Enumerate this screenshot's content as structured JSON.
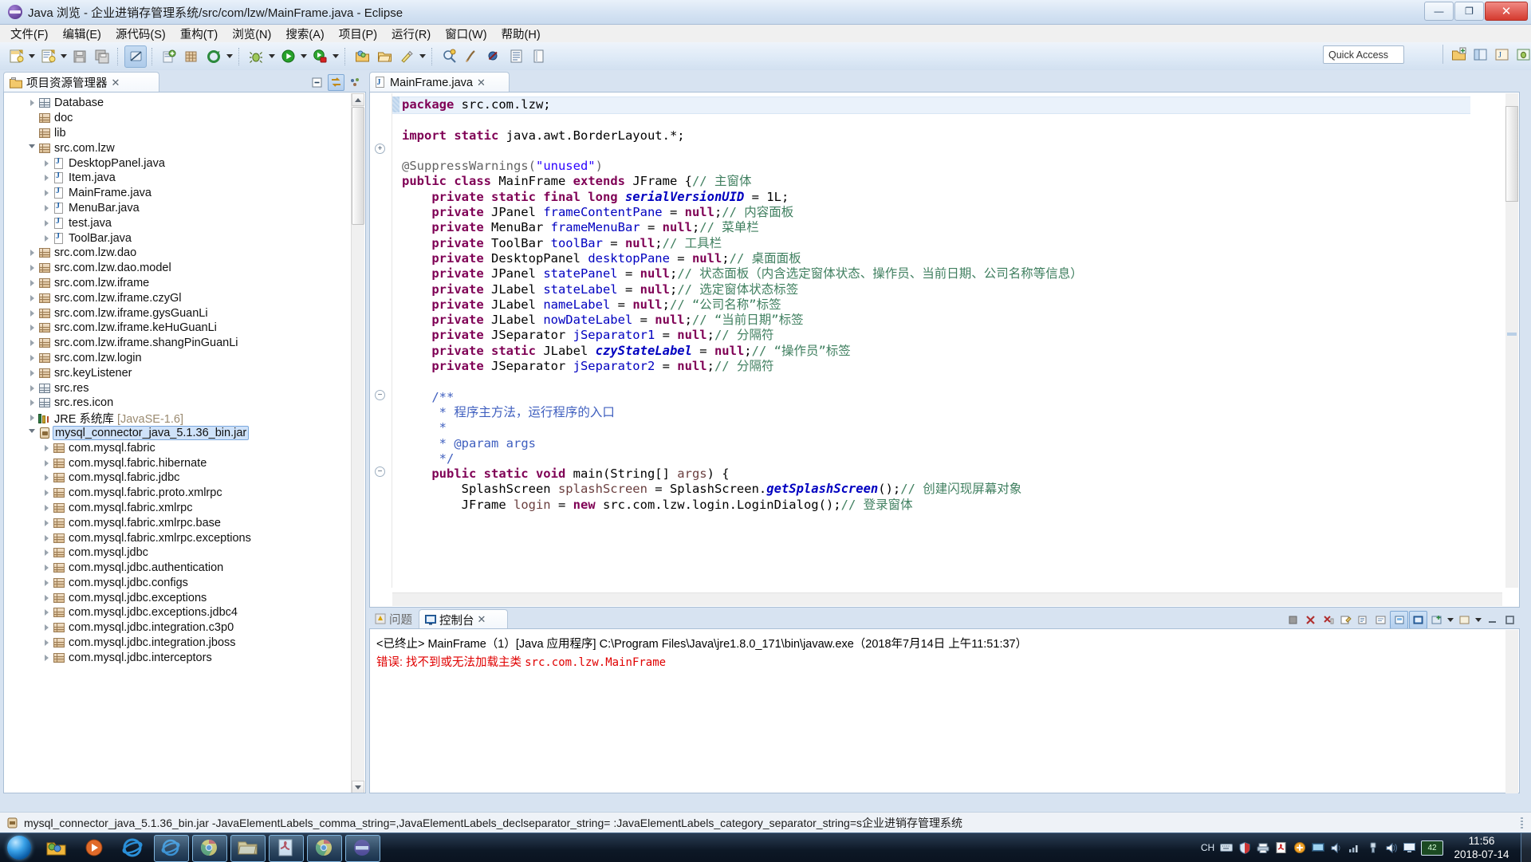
{
  "window": {
    "title": "Java 浏览 - 企业进销存管理系统/src/com/lzw/MainFrame.java - Eclipse",
    "minimize_label": "—",
    "maximize_label": "❐",
    "close_label": "✕"
  },
  "menubar": {
    "items": [
      "文件(F)",
      "编辑(E)",
      "源代码(S)",
      "重构(T)",
      "浏览(N)",
      "搜索(A)",
      "项目(P)",
      "运行(R)",
      "窗口(W)",
      "帮助(H)"
    ]
  },
  "toolbar": {
    "quick_access_placeholder": "Quick Access",
    "buttons": [
      "new-wizard",
      "new-java-class",
      "save",
      "save-all",
      "toggle-link",
      "new-java-project",
      "open-type",
      "debug",
      "run",
      "run-coverage",
      "new-package",
      "open-task",
      "external-tools",
      "search",
      "annotate",
      "skip-breakpoints",
      "outline",
      "pin"
    ]
  },
  "project_explorer": {
    "tab_label": "项目资源管理器",
    "tab_close": "✕",
    "view_icons": [
      "collapse-all-icon",
      "link-with-editor-icon",
      "view-menu-icon"
    ],
    "tree": [
      {
        "label": "Database",
        "indent": 1,
        "icon": "src-folder",
        "twisty": "closed"
      },
      {
        "label": "doc",
        "indent": 1,
        "icon": "pkg-folder",
        "twisty": "none"
      },
      {
        "label": "lib",
        "indent": 1,
        "icon": "pkg-folder",
        "twisty": "none"
      },
      {
        "label": "src.com.lzw",
        "indent": 1,
        "icon": "pkg-folder",
        "twisty": "open"
      },
      {
        "label": "DesktopPanel.java",
        "indent": 2,
        "icon": "java",
        "twisty": "closed"
      },
      {
        "label": "Item.java",
        "indent": 2,
        "icon": "java",
        "twisty": "closed"
      },
      {
        "label": "MainFrame.java",
        "indent": 2,
        "icon": "java",
        "twisty": "closed"
      },
      {
        "label": "MenuBar.java",
        "indent": 2,
        "icon": "java",
        "twisty": "closed"
      },
      {
        "label": "test.java",
        "indent": 2,
        "icon": "java",
        "twisty": "closed"
      },
      {
        "label": "ToolBar.java",
        "indent": 2,
        "icon": "java",
        "twisty": "closed"
      },
      {
        "label": "src.com.lzw.dao",
        "indent": 1,
        "icon": "pkg-folder",
        "twisty": "closed"
      },
      {
        "label": "src.com.lzw.dao.model",
        "indent": 1,
        "icon": "pkg-folder",
        "twisty": "closed"
      },
      {
        "label": "src.com.lzw.iframe",
        "indent": 1,
        "icon": "pkg-folder",
        "twisty": "closed"
      },
      {
        "label": "src.com.lzw.iframe.czyGl",
        "indent": 1,
        "icon": "pkg-folder",
        "twisty": "closed"
      },
      {
        "label": "src.com.lzw.iframe.gysGuanLi",
        "indent": 1,
        "icon": "pkg-folder",
        "twisty": "closed"
      },
      {
        "label": "src.com.lzw.iframe.keHuGuanLi",
        "indent": 1,
        "icon": "pkg-folder",
        "twisty": "closed"
      },
      {
        "label": "src.com.lzw.iframe.shangPinGuanLi",
        "indent": 1,
        "icon": "pkg-folder",
        "twisty": "closed"
      },
      {
        "label": "src.com.lzw.login",
        "indent": 1,
        "icon": "pkg-folder",
        "twisty": "closed"
      },
      {
        "label": "src.keyListener",
        "indent": 1,
        "icon": "pkg-folder",
        "twisty": "closed"
      },
      {
        "label": "src.res",
        "indent": 1,
        "icon": "src-folder",
        "twisty": "closed"
      },
      {
        "label": "src.res.icon",
        "indent": 1,
        "icon": "src-folder",
        "twisty": "closed"
      },
      {
        "label": "JRE 系统库 ",
        "dim": "[JavaSE-1.6]",
        "indent": 1,
        "icon": "jre",
        "twisty": "closed"
      },
      {
        "label": "mysql_connector_java_5.1.36_bin.jar",
        "indent": 1,
        "icon": "jar",
        "twisty": "open",
        "selected": true
      },
      {
        "label": "com.mysql.fabric",
        "indent": 2,
        "icon": "pkg-folder",
        "twisty": "closed"
      },
      {
        "label": "com.mysql.fabric.hibernate",
        "indent": 2,
        "icon": "pkg-folder",
        "twisty": "closed"
      },
      {
        "label": "com.mysql.fabric.jdbc",
        "indent": 2,
        "icon": "pkg-folder",
        "twisty": "closed"
      },
      {
        "label": "com.mysql.fabric.proto.xmlrpc",
        "indent": 2,
        "icon": "pkg-folder",
        "twisty": "closed"
      },
      {
        "label": "com.mysql.fabric.xmlrpc",
        "indent": 2,
        "icon": "pkg-folder",
        "twisty": "closed"
      },
      {
        "label": "com.mysql.fabric.xmlrpc.base",
        "indent": 2,
        "icon": "pkg-folder",
        "twisty": "closed"
      },
      {
        "label": "com.mysql.fabric.xmlrpc.exceptions",
        "indent": 2,
        "icon": "pkg-folder",
        "twisty": "closed"
      },
      {
        "label": "com.mysql.jdbc",
        "indent": 2,
        "icon": "pkg-folder",
        "twisty": "closed"
      },
      {
        "label": "com.mysql.jdbc.authentication",
        "indent": 2,
        "icon": "pkg-folder",
        "twisty": "closed"
      },
      {
        "label": "com.mysql.jdbc.configs",
        "indent": 2,
        "icon": "pkg-folder",
        "twisty": "closed"
      },
      {
        "label": "com.mysql.jdbc.exceptions",
        "indent": 2,
        "icon": "pkg-folder",
        "twisty": "closed"
      },
      {
        "label": "com.mysql.jdbc.exceptions.jdbc4",
        "indent": 2,
        "icon": "pkg-folder",
        "twisty": "closed"
      },
      {
        "label": "com.mysql.jdbc.integration.c3p0",
        "indent": 2,
        "icon": "pkg-folder",
        "twisty": "closed"
      },
      {
        "label": "com.mysql.jdbc.integration.jboss",
        "indent": 2,
        "icon": "pkg-folder",
        "twisty": "closed"
      },
      {
        "label": "com.mysql.jdbc.interceptors",
        "indent": 2,
        "icon": "pkg-folder",
        "twisty": "closed"
      }
    ]
  },
  "editor": {
    "tab_label": "MainFrame.java",
    "tab_close": "✕",
    "lines": [
      [
        {
          "t": "package ",
          "c": "kw"
        },
        {
          "t": "src.com.lzw;",
          "c": "pl"
        }
      ],
      [],
      [
        {
          "t": "import static ",
          "c": "kw"
        },
        {
          "t": "java.awt.BorderLayout.*;",
          "c": "pl"
        }
      ],
      [],
      [
        {
          "t": "@SuppressWarnings(",
          "c": "ann"
        },
        {
          "t": "\"unused\"",
          "c": "str"
        },
        {
          "t": ")",
          "c": "ann"
        }
      ],
      [
        {
          "t": "public class ",
          "c": "kw"
        },
        {
          "t": "MainFrame ",
          "c": "pl"
        },
        {
          "t": "extends ",
          "c": "kw"
        },
        {
          "t": "JFrame {",
          "c": "pl"
        },
        {
          "t": "// 主窗体",
          "c": "cm"
        }
      ],
      [
        {
          "t": "    private static final long ",
          "c": "kw"
        },
        {
          "t": "serialVersionUID",
          "c": "fldi"
        },
        {
          "t": " = 1L;",
          "c": "pl"
        }
      ],
      [
        {
          "t": "    private ",
          "c": "kw"
        },
        {
          "t": "JPanel ",
          "c": "pl"
        },
        {
          "t": "frameContentPane",
          "c": "fld"
        },
        {
          "t": " = ",
          "c": "pl"
        },
        {
          "t": "null",
          "c": "kw"
        },
        {
          "t": ";",
          "c": "pl"
        },
        {
          "t": "// 内容面板",
          "c": "cm"
        }
      ],
      [
        {
          "t": "    private ",
          "c": "kw"
        },
        {
          "t": "MenuBar ",
          "c": "pl"
        },
        {
          "t": "frameMenuBar",
          "c": "fld"
        },
        {
          "t": " = ",
          "c": "pl"
        },
        {
          "t": "null",
          "c": "kw"
        },
        {
          "t": ";",
          "c": "pl"
        },
        {
          "t": "// 菜单栏",
          "c": "cm"
        }
      ],
      [
        {
          "t": "    private ",
          "c": "kw"
        },
        {
          "t": "ToolBar ",
          "c": "pl"
        },
        {
          "t": "toolBar",
          "c": "fld"
        },
        {
          "t": " = ",
          "c": "pl"
        },
        {
          "t": "null",
          "c": "kw"
        },
        {
          "t": ";",
          "c": "pl"
        },
        {
          "t": "// 工具栏",
          "c": "cm"
        }
      ],
      [
        {
          "t": "    private ",
          "c": "kw"
        },
        {
          "t": "DesktopPanel ",
          "c": "pl"
        },
        {
          "t": "desktopPane",
          "c": "fld"
        },
        {
          "t": " = ",
          "c": "pl"
        },
        {
          "t": "null",
          "c": "kw"
        },
        {
          "t": ";",
          "c": "pl"
        },
        {
          "t": "// 桌面面板",
          "c": "cm"
        }
      ],
      [
        {
          "t": "    private ",
          "c": "kw"
        },
        {
          "t": "JPanel ",
          "c": "pl"
        },
        {
          "t": "statePanel",
          "c": "fld"
        },
        {
          "t": " = ",
          "c": "pl"
        },
        {
          "t": "null",
          "c": "kw"
        },
        {
          "t": ";",
          "c": "pl"
        },
        {
          "t": "// 状态面板（内含选定窗体状态、操作员、当前日期、公司名称等信息）",
          "c": "cm"
        }
      ],
      [
        {
          "t": "    private ",
          "c": "kw"
        },
        {
          "t": "JLabel ",
          "c": "pl"
        },
        {
          "t": "stateLabel",
          "c": "fld"
        },
        {
          "t": " = ",
          "c": "pl"
        },
        {
          "t": "null",
          "c": "kw"
        },
        {
          "t": ";",
          "c": "pl"
        },
        {
          "t": "// 选定窗体状态标签",
          "c": "cm"
        }
      ],
      [
        {
          "t": "    private ",
          "c": "kw"
        },
        {
          "t": "JLabel ",
          "c": "pl"
        },
        {
          "t": "nameLabel",
          "c": "fld"
        },
        {
          "t": " = ",
          "c": "pl"
        },
        {
          "t": "null",
          "c": "kw"
        },
        {
          "t": ";",
          "c": "pl"
        },
        {
          "t": "// “公司名称”标签",
          "c": "cm"
        }
      ],
      [
        {
          "t": "    private ",
          "c": "kw"
        },
        {
          "t": "JLabel ",
          "c": "pl"
        },
        {
          "t": "nowDateLabel",
          "c": "fld"
        },
        {
          "t": " = ",
          "c": "pl"
        },
        {
          "t": "null",
          "c": "kw"
        },
        {
          "t": ";",
          "c": "pl"
        },
        {
          "t": "// “当前日期”标签",
          "c": "cm"
        }
      ],
      [
        {
          "t": "    private ",
          "c": "kw"
        },
        {
          "t": "JSeparator ",
          "c": "pl"
        },
        {
          "t": "jSeparator1",
          "c": "fld"
        },
        {
          "t": " = ",
          "c": "pl"
        },
        {
          "t": "null",
          "c": "kw"
        },
        {
          "t": ";",
          "c": "pl"
        },
        {
          "t": "// 分隔符",
          "c": "cm"
        }
      ],
      [
        {
          "t": "    private static ",
          "c": "kw"
        },
        {
          "t": "JLabel ",
          "c": "pl"
        },
        {
          "t": "czyStateLabel",
          "c": "fldi"
        },
        {
          "t": " = ",
          "c": "pl"
        },
        {
          "t": "null",
          "c": "kw"
        },
        {
          "t": ";",
          "c": "pl"
        },
        {
          "t": "// “操作员”标签",
          "c": "cm"
        }
      ],
      [
        {
          "t": "    private ",
          "c": "kw"
        },
        {
          "t": "JSeparator ",
          "c": "pl"
        },
        {
          "t": "jSeparator2",
          "c": "fld"
        },
        {
          "t": " = ",
          "c": "pl"
        },
        {
          "t": "null",
          "c": "kw"
        },
        {
          "t": ";",
          "c": "pl"
        },
        {
          "t": "// 分隔符",
          "c": "cm"
        }
      ],
      [],
      [
        {
          "t": "    /**",
          "c": "jd"
        }
      ],
      [
        {
          "t": "     * 程序主方法，运行程序的入口",
          "c": "jd"
        }
      ],
      [
        {
          "t": "     *",
          "c": "jd"
        }
      ],
      [
        {
          "t": "     * @param ",
          "c": "jd"
        },
        {
          "t": "args",
          "c": "jd"
        }
      ],
      [
        {
          "t": "     */",
          "c": "jd"
        }
      ],
      [
        {
          "t": "    public static void ",
          "c": "kw"
        },
        {
          "t": "main(String[] ",
          "c": "pl"
        },
        {
          "t": "args",
          "c": "loc"
        },
        {
          "t": ") {",
          "c": "pl"
        }
      ],
      [
        {
          "t": "        SplashScreen ",
          "c": "pl"
        },
        {
          "t": "splashScreen",
          "c": "loc"
        },
        {
          "t": " = SplashScreen.",
          "c": "pl"
        },
        {
          "t": "getSplashScreen",
          "c": "fldi"
        },
        {
          "t": "();",
          "c": "pl"
        },
        {
          "t": "// 创建闪现屏幕对象",
          "c": "cm"
        }
      ],
      [
        {
          "t": "        JFrame ",
          "c": "pl"
        },
        {
          "t": "login",
          "c": "loc"
        },
        {
          "t": " = ",
          "c": "pl"
        },
        {
          "t": "new ",
          "c": "kw"
        },
        {
          "t": "src.com.lzw.login.LoginDialog();",
          "c": "pl"
        },
        {
          "t": "// 登录窗体",
          "c": "cm"
        }
      ]
    ]
  },
  "console": {
    "tabs": [
      {
        "label": "问题",
        "active": false,
        "icon": "problems-icon"
      },
      {
        "label": "控制台",
        "active": true,
        "icon": "console-icon",
        "close": "✕"
      }
    ],
    "header_line": "<已终止> MainFrame（1）[Java 应用程序] C:\\Program Files\\Java\\jre1.8.0_171\\bin\\javaw.exe（2018年7月14日 上午11:51:37）",
    "error_prefix": "错误: 找不到或无法加载主类 ",
    "error_class": "src.com.lzw.MainFrame",
    "tool_buttons": [
      "terminate",
      "remove-launch",
      "remove-all-terminated",
      "clear-console",
      "scroll-lock",
      "word-wrap",
      "pin-console",
      "display-selected-console",
      "open-console",
      "new-console-view",
      "minimize",
      "maximize"
    ]
  },
  "statusbar": {
    "icon": "jar-icon",
    "text": "mysql_connector_java_5.1.36_bin.jar -JavaElementLabels_comma_string=,JavaElementLabels_declseparator_string= :JavaElementLabels_category_separator_string=s企业进销存管理系统"
  },
  "taskbar": {
    "start_label": "start-orb",
    "items": [
      "explorer-taskbar-icon",
      "media-player-icon",
      "internet-explorer-icon",
      "ie-window-icon",
      "chrome-window-icon",
      "folder-window-icon",
      "pdf-reader-icon",
      "chrome-2-icon",
      "eclipse-window-icon"
    ],
    "tray": {
      "ime": "CH",
      "icons": [
        "keyboard-icon",
        "shield-icon",
        "printer-icon",
        "pdf-tray-icon",
        "plus-tray-icon",
        "monitor-icon",
        "sound-tray-icon",
        "network-icon",
        "usb-icon",
        "volume-icon",
        "display-icon"
      ],
      "battery": "42",
      "time": "11:56",
      "date": "2018-07-14"
    }
  },
  "colors": {
    "accent": "#3a7ec8",
    "error": "#e00000",
    "keyword": "#7f0055",
    "string": "#2a00ff",
    "comment": "#3f7f5f",
    "javadoc": "#3f5fbf",
    "field": "#0000c0",
    "selection": "#cfe2f9"
  }
}
